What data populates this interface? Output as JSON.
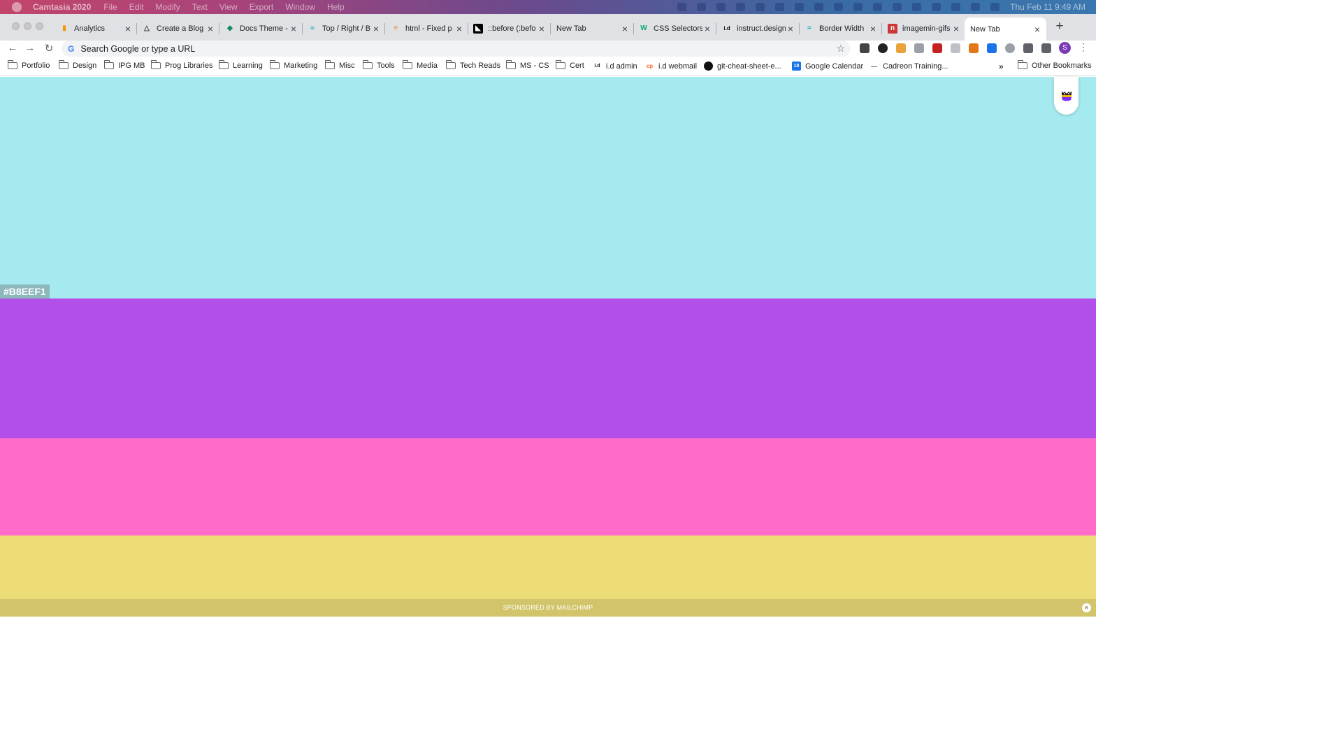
{
  "menubar": {
    "app_name": "Camtasia 2020",
    "items": [
      "File",
      "Edit",
      "Modify",
      "Text",
      "View",
      "Export",
      "Window",
      "Help"
    ],
    "clock": "Thu Feb 11  9:49 AM"
  },
  "tabs": [
    {
      "title": "Analytics",
      "icon": "analytics-icon",
      "active": false
    },
    {
      "title": "Create a Blog",
      "icon": "netlify-icon",
      "active": false
    },
    {
      "title": "Docs Theme -",
      "icon": "docs-icon",
      "active": false
    },
    {
      "title": "Top / Right / B",
      "icon": "tailwind-icon",
      "active": false
    },
    {
      "title": "html - Fixed p",
      "icon": "stackoverflow-icon",
      "active": false
    },
    {
      "title": "::before (:befo",
      "icon": "mdn-icon",
      "active": false
    },
    {
      "title": "New Tab",
      "icon": "",
      "active": false
    },
    {
      "title": "CSS Selectors",
      "icon": "w3schools-icon",
      "active": false
    },
    {
      "title": "instruct.design",
      "icon": "id-icon",
      "active": false
    },
    {
      "title": "Border Width",
      "icon": "tailwind-icon",
      "active": false
    },
    {
      "title": "imagemin-gifs",
      "icon": "npm-icon",
      "active": false
    },
    {
      "title": "New Tab",
      "icon": "",
      "active": true
    }
  ],
  "new_tab_label": "+",
  "omnibox": {
    "placeholder": "Search Google or type a URL",
    "g_label": "G"
  },
  "profile_initial": "S",
  "bookmarks": [
    {
      "label": "Portfolio",
      "type": "folder"
    },
    {
      "label": "Design",
      "type": "folder"
    },
    {
      "label": "IPG MB",
      "type": "folder"
    },
    {
      "label": "Prog Libraries",
      "type": "folder"
    },
    {
      "label": "Learning",
      "type": "folder"
    },
    {
      "label": "Marketing",
      "type": "folder"
    },
    {
      "label": "Misc",
      "type": "folder"
    },
    {
      "label": "Tools",
      "type": "folder"
    },
    {
      "label": "Media",
      "type": "folder"
    },
    {
      "label": "Tech Reads",
      "type": "folder"
    },
    {
      "label": "MS - CS",
      "type": "folder"
    },
    {
      "label": "Cert",
      "type": "folder"
    },
    {
      "label": "i.d admin",
      "type": "link",
      "icon_text": "i.d"
    },
    {
      "label": "i.d webmail",
      "type": "link",
      "icon_text": "cp"
    },
    {
      "label": "git-cheat-sheet-e...",
      "type": "link",
      "icon_text": "gh"
    },
    {
      "label": "Google Calendar",
      "type": "link",
      "icon_text": "18"
    },
    {
      "label": "Cadreon Training...",
      "type": "link",
      "icon_text": "—"
    }
  ],
  "bookmarks_overflow": "»",
  "other_bookmarks": "Other Bookmarks",
  "palette": {
    "stripes": [
      {
        "hex": "#A5EAEE"
      },
      {
        "hex": "#B34FE9"
      },
      {
        "hex": "#FF6BC9"
      },
      {
        "hex": "#EDDD79"
      }
    ],
    "active_label": "#B8EEF1"
  },
  "sponsor": {
    "text": "SPONSORED BY MAILCHIMP",
    "close_label": "×"
  }
}
